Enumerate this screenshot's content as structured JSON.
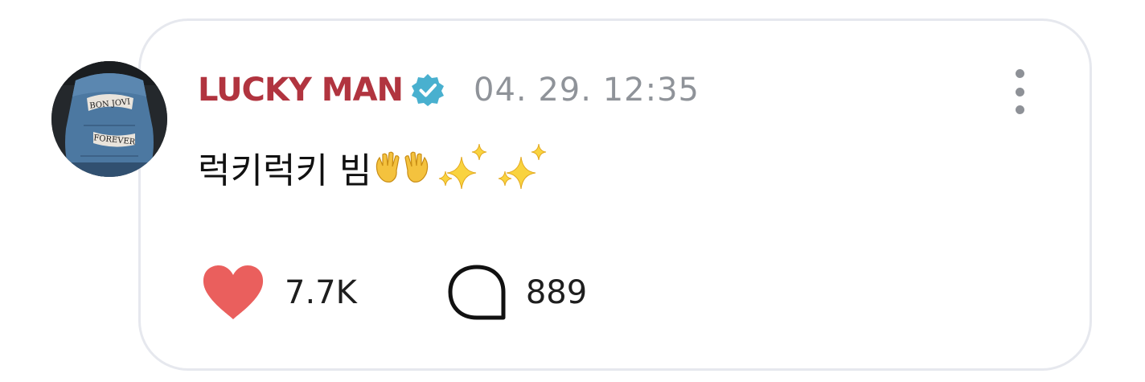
{
  "post": {
    "username": "LUCKY MAN",
    "verified": true,
    "timestamp": "04. 29. 12:35",
    "message": "럭키럭키 빔",
    "emojis": [
      "open-hands",
      "sparkles",
      "sparkles"
    ]
  },
  "avatar": {
    "patch_top": "BON JOVI",
    "patch_bottom": "FOREVER"
  },
  "stats": {
    "likes": "7.7K",
    "comments": "889"
  },
  "colors": {
    "username": "#b1343f",
    "verified_badge": "#49b0cf",
    "timestamp": "#8f9399",
    "heart": "#ea5f5d",
    "card_border": "#e6e8ee"
  },
  "icons": {
    "menu": "more-vertical-icon",
    "like": "heart-icon",
    "comment": "comment-bubble-icon",
    "verified": "verified-badge-icon"
  }
}
